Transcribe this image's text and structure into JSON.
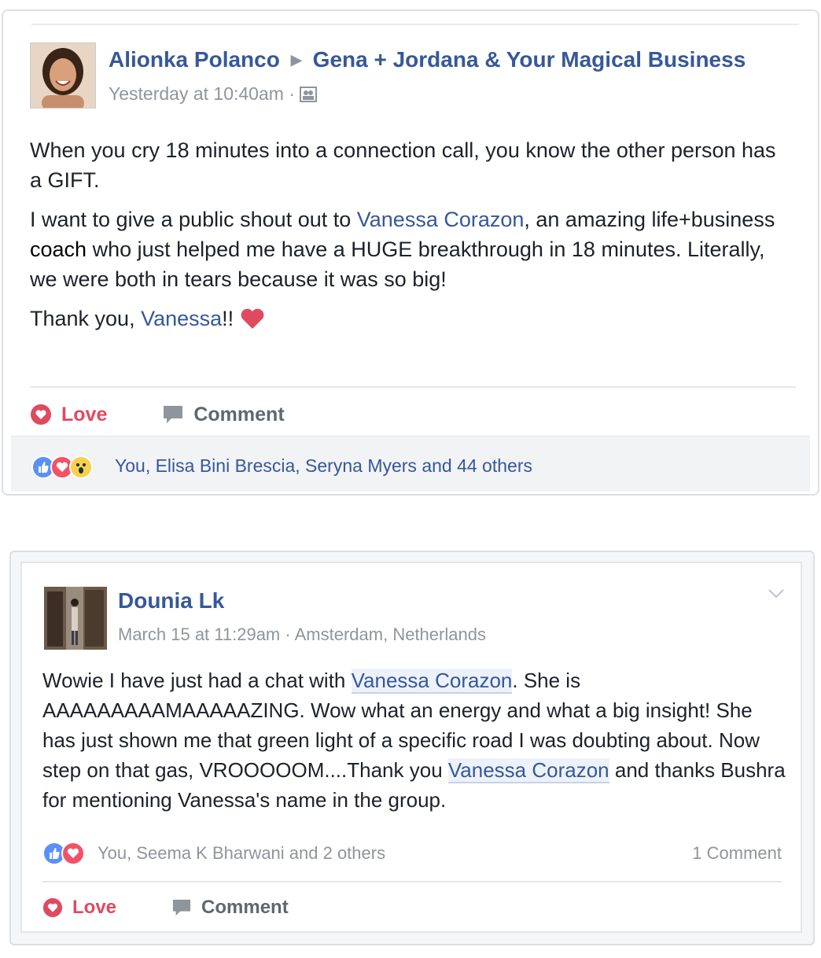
{
  "post1": {
    "author": "Alionka Polanco",
    "group": "Gena + Jordana & Your Magical Business",
    "timestamp": "Yesterday at 10:40am",
    "meta_separator": "·",
    "audience_icon": "group-audience-icon",
    "body": {
      "p1": "When you cry 18 minutes into a connection call, you know the other person has a GIFT.",
      "p2_a": "I want to give a public shout out to ",
      "p2_link": "Vanessa Corazon",
      "p2_b": ", an amazing life+business ",
      "p2_bold": "coach",
      "p2_c": " who just helped me have a HUGE breakthrough in 18 minutes. Literally, we were both in tears because it was so big!",
      "p3_a": "Thank you, ",
      "p3_link": "Vanessa",
      "p3_b": "!! "
    },
    "actions": {
      "love": "Love",
      "comment": "Comment"
    },
    "reactions": {
      "icons": [
        "like-reaction-icon",
        "love-reaction-icon",
        "wow-reaction-icon"
      ],
      "names": "You, Elisa Bini Brescia, Seryna Myers and 44 others"
    }
  },
  "post2": {
    "author": "Dounia Lk",
    "timestamp": "March 15 at 11:29am",
    "meta_separator": "·",
    "location": "Amsterdam, Netherlands",
    "body": {
      "a": "Wowie I have just had a chat with ",
      "link1": "Vanessa Corazon",
      "b": ". She is AAAAAAAAAMAAAAAZING. Wow what an energy and what a big insight! She has just shown me that green light of a specific road I was doubting about. Now step on that gas, VROOOOOM....Thank you ",
      "link2": "Vanessa Corazon",
      "c": " and thanks Bushra for mentioning Vanessa's name in the group."
    },
    "reactions": {
      "icons": [
        "like-reaction-icon",
        "love-reaction-icon"
      ],
      "names": "You, Seema K Bharwani and 2 others",
      "comments": "1 Comment"
    },
    "actions": {
      "love": "Love",
      "comment": "Comment"
    }
  },
  "colors": {
    "link": "#365899",
    "love": "#e04a5f",
    "muted": "#90949c"
  }
}
